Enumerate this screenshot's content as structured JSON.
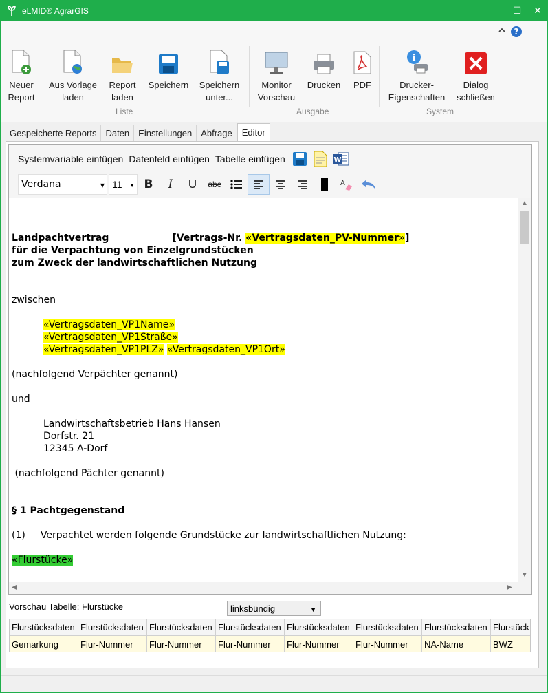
{
  "window": {
    "title": "eLMID® AgrarGIS",
    "controls": {
      "minimize": "—",
      "maximize": "☐",
      "close": "✕"
    }
  },
  "ribbon_top": {
    "collapse_icon": "chevron-up-icon",
    "help_icon": "help-icon"
  },
  "ribbon": {
    "groups": {
      "liste": "Liste",
      "ausgabe": "Ausgabe",
      "system": "System"
    },
    "buttons": {
      "neuer_report": {
        "line1": "Neuer",
        "line2": "Report"
      },
      "aus_vorlage": {
        "line1": "Aus Vorlage",
        "line2": "laden"
      },
      "report_laden": {
        "line1": "Report",
        "line2": "laden"
      },
      "speichern": {
        "line1": "Speichern",
        "line2": ""
      },
      "speichern_unter": {
        "line1": "Speichern",
        "line2": "unter..."
      },
      "monitor_vorschau": {
        "line1": "Monitor",
        "line2": "Vorschau"
      },
      "drucken": {
        "line1": "Drucken",
        "line2": ""
      },
      "pdf": {
        "line1": "PDF",
        "line2": ""
      },
      "drucker_eigenschaften": {
        "line1": "Drucker-",
        "line2": "Eigenschaften"
      },
      "dialog_schliessen": {
        "line1": "Dialog",
        "line2": "schließen"
      }
    }
  },
  "tabs": [
    "Gespeicherte Reports",
    "Daten",
    "Einstellungen",
    "Abfrage",
    "Editor"
  ],
  "active_tab": "Editor",
  "editor_toolbar": {
    "insert_system_variable": "Systemvariable einfügen",
    "insert_data_field": "Datenfeld einfügen",
    "insert_table": "Tabelle einfügen",
    "font": "Verdana",
    "size": "11",
    "bold": "B",
    "italic": "I",
    "underline": "U",
    "strike": "abc"
  },
  "document": {
    "heading_title": "Landpachtvertrag",
    "contract_no_prefix": "[Vertrags-Nr. ",
    "contract_no_field": "«Vertragsdaten_PV-Nummer»",
    "contract_no_suffix": "]",
    "heading_line2": "für die Verpachtung von Einzelgrundstücken",
    "heading_line3": "zum Zweck der landwirtschaftlichen Nutzung",
    "zwischen": "zwischen",
    "vp1_name": "«Vertragsdaten_VP1Name»",
    "vp1_strasse": "«Vertragsdaten_VP1Straße»",
    "vp1_plz": "«Vertragsdaten_VP1PLZ»",
    "vp1_ort": "«Vertragsdaten_VP1Ort»",
    "verpaechter": "(nachfolgend Verpächter genannt)",
    "und": "und",
    "paechter_name": "Landwirtschaftsbetrieb Hans Hansen",
    "paechter_strasse": "Dorfstr. 21",
    "paechter_ort": "12345 A-Dorf",
    "paechter": " (nachfolgend Pächter genannt)",
    "section1": "§ 1 Pachtgegenstand",
    "para1_num": "(1)",
    "para1_text": "Verpachtet werden folgende Grundstücke zur landwirtschaftlichen Nutzung:",
    "flurstuecke_field": "«Flurstücke»"
  },
  "preview": {
    "label": "Vorschau Tabelle: Flurstücke",
    "alignment": "linksbündig",
    "headers": [
      "Flurstücksdaten",
      "Flurstücksdaten",
      "Flurstücksdaten",
      "Flurstücksdaten",
      "Flurstücksdaten",
      "Flurstücksdaten",
      "Flurstücksdaten",
      "Flurstück"
    ],
    "row": [
      "Gemarkung",
      "Flur-Nummer",
      "Flur-Nummer",
      "Flur-Nummer",
      "Flur-Nummer",
      "Flur-Nummer",
      "NA-Name",
      "BWZ"
    ]
  },
  "colors": {
    "titlebar": "#1fae4b",
    "highlight_yellow": "#ffff00",
    "highlight_green": "#33cc33"
  }
}
